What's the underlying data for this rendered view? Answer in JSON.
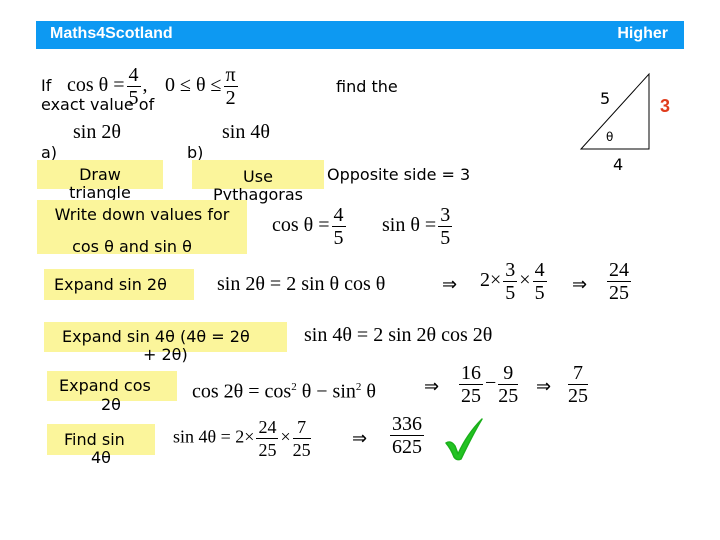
{
  "header": {
    "title": "Maths4Scotland",
    "level": "Higher",
    "color": "#0d99f2"
  },
  "question": {
    "if": "If",
    "cos_theta_lhs": "cos θ =",
    "cos_num": "4",
    "cos_den": "5",
    "comma": ",",
    "range_lhs": "0 ≤ θ ≤",
    "range_num": "π",
    "range_den": "2",
    "find_the": "find the",
    "exact_value_of": "exact value of",
    "part_a_expr": "sin 2θ",
    "part_b_expr": "sin 4θ",
    "part_a_label": "a)",
    "part_b_label": "b)"
  },
  "triangle": {
    "hypotenuse": "5",
    "opposite": "3",
    "adjacent": "4",
    "angle": "θ",
    "opposite_color": "#e03c1c"
  },
  "steps": {
    "draw_line1": "Draw",
    "draw_line2": "triangle",
    "use_line1": "Use",
    "use_line2": "Pythagoras",
    "opposite_side": "Opposite side = 3",
    "write_line1": "Write down values for",
    "write_line2": "cos θ and sin θ",
    "cos_value_lhs": "cos θ =",
    "cos_value_num": "4",
    "cos_value_den": "5",
    "sin_value_lhs": "sin θ =",
    "sin_value_num": "3",
    "sin_value_den": "5",
    "expand_sin2": "Expand  sin 2θ",
    "sin2_identity": "sin 2θ = 2 sin θ cos θ",
    "arrow": "⇒",
    "sin2_calc_prefix": "2×",
    "sin2_calc_f1_num": "3",
    "sin2_calc_f1_den": "5",
    "times": "×",
    "sin2_calc_f2_num": "4",
    "sin2_calc_f2_den": "5",
    "sin2_result_num": "24",
    "sin2_result_den": "25",
    "expand_sin4_line1": "Expand  sin 4θ (4θ = 2θ",
    "expand_sin4_line2": "+ 2θ)",
    "sin4_identity": "sin 4θ = 2 sin 2θ cos 2θ",
    "expand_cos2_line1": "Expand  cos",
    "expand_cos2_line2": "2θ",
    "cos2_identity_lhs": "cos 2θ = cos",
    "cos2_sq": "2",
    "cos2_identity_mid": " θ − sin",
    "cos2_identity_end": " θ",
    "cos2_f1_num": "16",
    "cos2_f1_den": "25",
    "minus": "−",
    "cos2_f2_num": "9",
    "cos2_f2_den": "25",
    "cos2_result_num": "7",
    "cos2_result_den": "25",
    "find_sin4_line1": "Find  sin",
    "find_sin4_line2": "4θ",
    "sin4_calc_lhs": "sin 4θ = 2×",
    "sin4_f1_num": "24",
    "sin4_f1_den": "25",
    "sin4_f2_num": "7",
    "sin4_f2_den": "25",
    "sin4_result_num": "336",
    "sin4_result_den": "625",
    "check_color": "#22c322"
  }
}
